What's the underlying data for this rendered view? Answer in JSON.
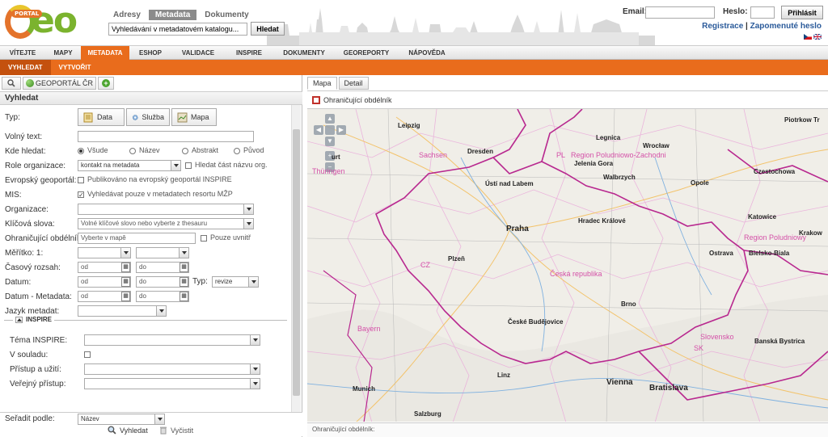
{
  "header": {
    "logo_badge": "PORTAL",
    "logo_text": "eo",
    "search_tabs": [
      "Adresy",
      "Metadata",
      "Dokumenty"
    ],
    "search_placeholder": "Vyhledávání v metadatovém katalogu...",
    "search_button": "Hledat",
    "email_label": "Email:",
    "password_label": "Heslo:",
    "login_button": "Přihlásit",
    "register_link": "Registrace",
    "forgot_link": "Zapomenuté heslo",
    "separator": "|"
  },
  "nav": {
    "items": [
      "VÍTEJTE",
      "MAPY",
      "METADATA",
      "ESHOP",
      "VALIDACE",
      "INSPIRE",
      "DOKUMENTY",
      "GEOREPORTY",
      "NÁPOVĚDA"
    ],
    "active": "METADATA"
  },
  "subnav": {
    "items": [
      "VYHLEDAT",
      "VYTVOŘIT"
    ],
    "active": "VYHLEDAT"
  },
  "left": {
    "toolbar_tab": "GEOPORTÁL ČR",
    "plus_symbol": "+",
    "header": "Vyhledat",
    "labels": {
      "type": "Typ:",
      "free_text": "Volný text:",
      "where": "Kde hledat:",
      "role": "Role organizace:",
      "eu": "Evropský geoportál:",
      "mis": "MIS:",
      "org": "Organizace:",
      "keywords": "Klíčová slova:",
      "bbox": "Ohraničující obdélník:",
      "scale": "Měřítko: 1:",
      "time": "Časový rozsah:",
      "date": "Datum:",
      "date_meta": "Datum - Metadata:",
      "lang": "Jazyk metadat:",
      "inspire_theme": "Téma INSPIRE:",
      "conform": "V souladu:",
      "access": "Přístup a užití:",
      "public": "Veřejný přístup:",
      "sort": "Seřadit podle:"
    },
    "type_buttons": [
      "Data",
      "Služba",
      "Mapa"
    ],
    "where_options": [
      "Všude",
      "Název",
      "Abstrakt",
      "Původ"
    ],
    "role_value": "kontakt na metadata",
    "role_check": "Hledat část názvu org.",
    "eu_check": "Publikováno na evropský geoportál INSPIRE",
    "mis_check": "Vyhledávat pouze v metadatech resortu MŽP",
    "mis_mark": "✓",
    "keywords_placeholder": "Volné klíčové slovo nebo vyberte z thesauru",
    "bbox_placeholder": "Vyberte v mapě",
    "bbox_check": "Pouze uvnitř",
    "from": "od",
    "to": "do",
    "date_type_label": "Typ:",
    "date_type_value": "revize",
    "inspire_legend": "INSPIRE",
    "sort_value": "Název",
    "find_button": "Vyhledat",
    "clear_button": "Vyčistit"
  },
  "right": {
    "tabs": [
      "Mapa",
      "Detail"
    ],
    "bbox_tool": "Ohraničující obdélník",
    "footer": "Ohraničující obdélník:",
    "map_buttons": {
      "up": "▲",
      "left": "◀",
      "right": "▶",
      "down": "▼",
      "zoom_in": "+",
      "zoom_out": "−"
    },
    "cities": [
      "Leipzig",
      "Dresden",
      "Legnica",
      "Wrocław",
      "Jelenia Gora",
      "Walbrzych",
      "Opole",
      "Piotrkow Tr",
      "Czestochowa",
      "Ústí nad Labem",
      "Hradec Králové",
      "Katowice",
      "Krakow",
      "Praha",
      "Ostrava",
      "Bielsko-Biala",
      "Plzeň",
      "Brno",
      "České Budějovice",
      "Banská Bystrica",
      "Linz",
      "Vienna",
      "Bratislava",
      "Munich",
      "Salzburg",
      "urt"
    ],
    "regions": [
      "Sachsen",
      "PL",
      "Region Poludniowo-Zachodni",
      "Region Poludniowy",
      "CZ",
      "Česká republika",
      "SK",
      "Slovensko",
      "Bayern",
      "Thüringen"
    ]
  }
}
